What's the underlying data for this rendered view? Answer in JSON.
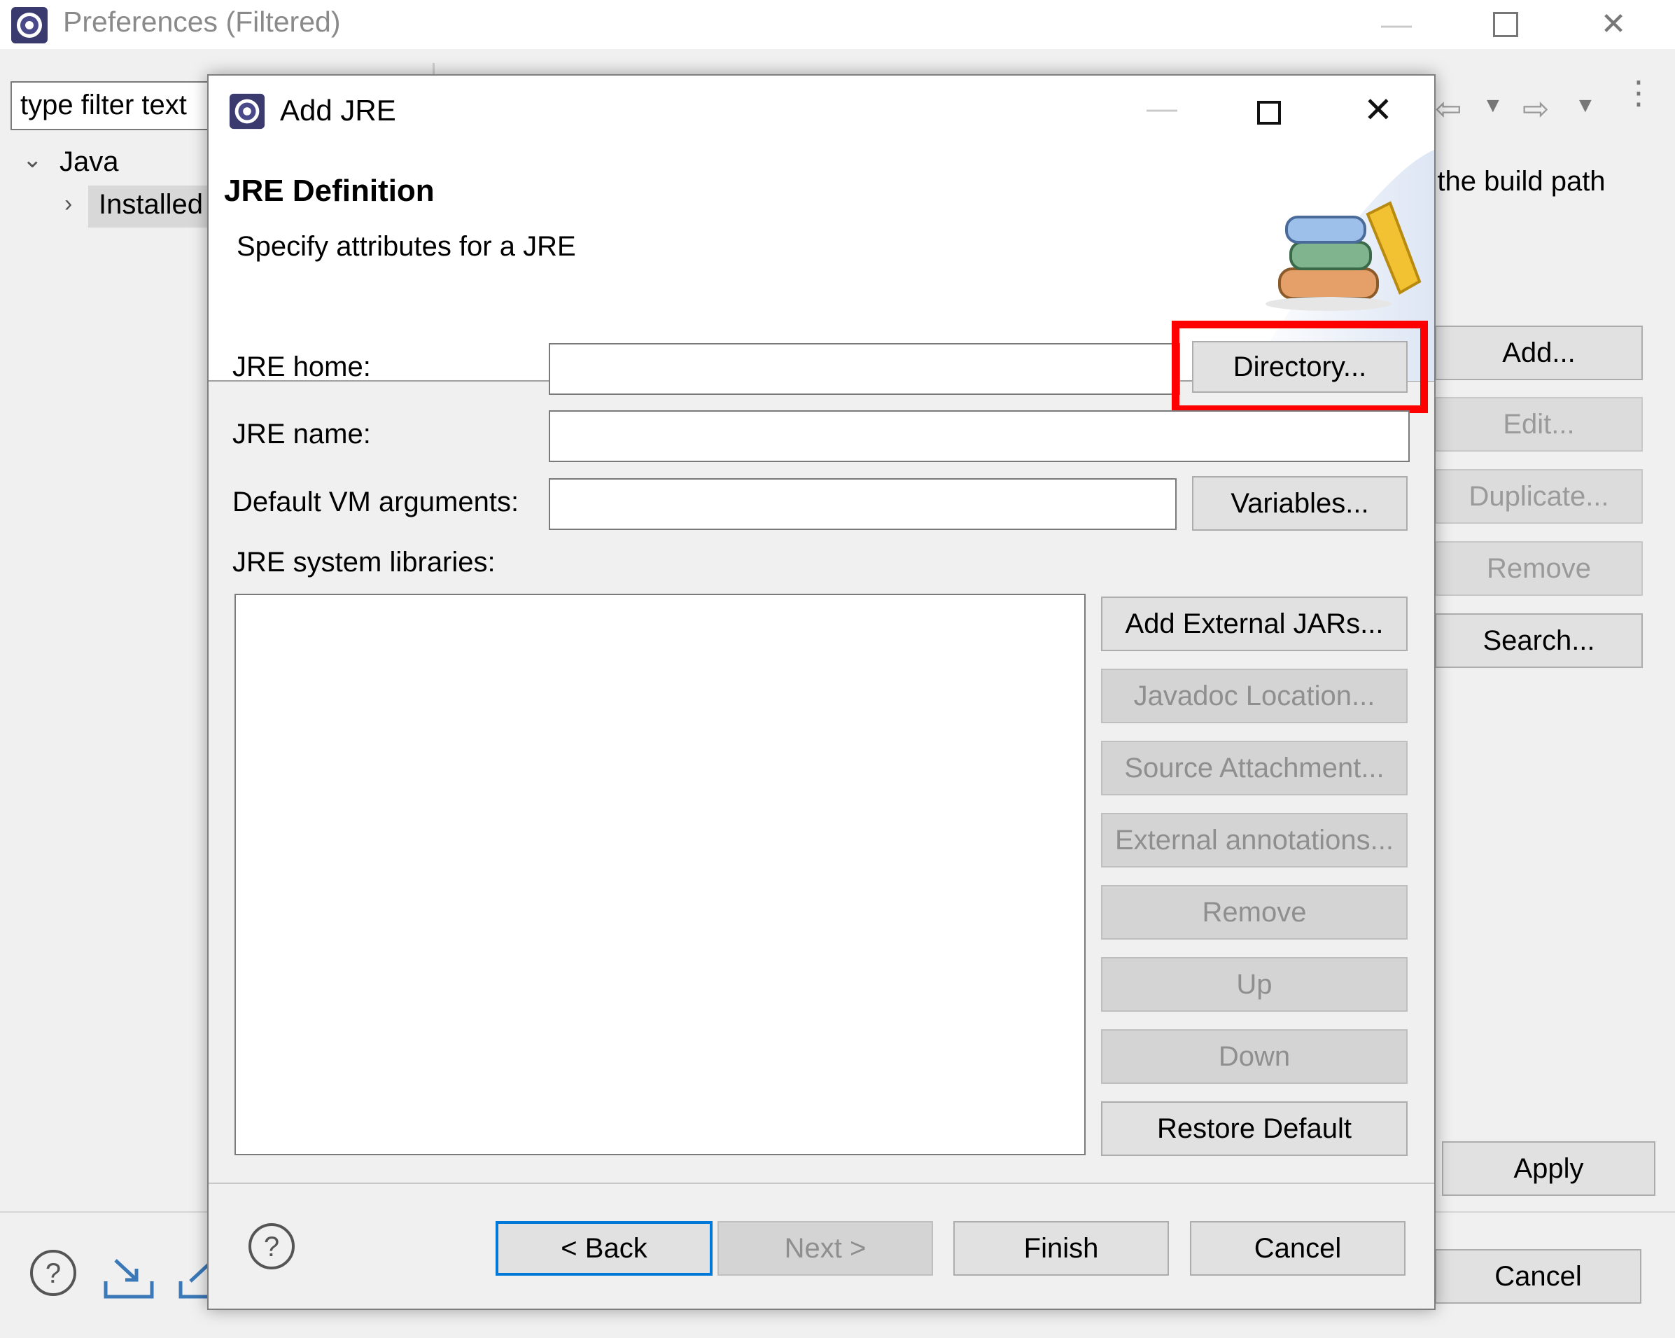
{
  "preferences": {
    "title": "Preferences (Filtered)",
    "filter_placeholder": "type filter text",
    "tree": {
      "java": "Java",
      "installed": "Installed"
    },
    "partial_text": "o the build path",
    "buttons": {
      "add": "Add...",
      "edit": "Edit...",
      "duplicate": "Duplicate...",
      "remove": "Remove",
      "search": "Search...",
      "apply": "Apply",
      "cancel": "Cancel"
    }
  },
  "dialog": {
    "title": "Add JRE",
    "header_title": "JRE Definition",
    "header_description": "Specify attributes for a JRE",
    "fields": {
      "jre_home_label": "JRE home:",
      "jre_home_value": "",
      "jre_name_label": "JRE name:",
      "jre_name_value": "",
      "vm_args_label": "Default VM arguments:",
      "vm_args_value": ""
    },
    "directory_button": "Directory...",
    "variables_button": "Variables...",
    "libraries_label": "JRE system libraries:",
    "library_buttons": {
      "add_external_jars": "Add External JARs...",
      "javadoc_location": "Javadoc Location...",
      "source_attachment": "Source Attachment...",
      "external_annotations": "External annotations...",
      "remove": "Remove",
      "up": "Up",
      "down": "Down",
      "restore_default": "Restore Default"
    },
    "footer": {
      "back": "< Back",
      "next": "Next >",
      "finish": "Finish",
      "cancel": "Cancel"
    }
  },
  "colors": {
    "highlight": "#ff0000",
    "default_button_border": "#0078d7",
    "disabled_text": "#8f8f8f"
  }
}
